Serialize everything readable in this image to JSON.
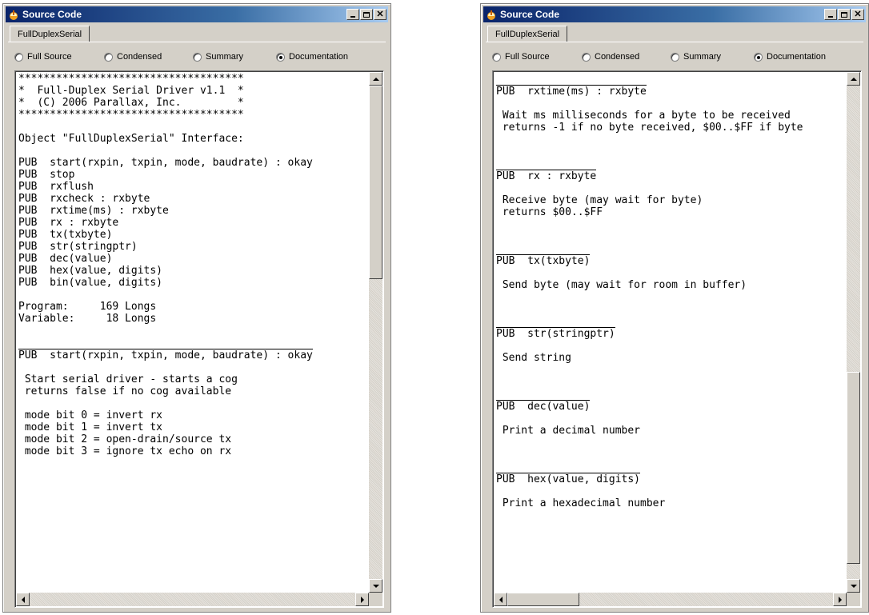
{
  "windows": [
    {
      "title": "Source Code",
      "tab": "FullDuplexSerial",
      "view_modes": [
        {
          "label": "Full Source",
          "selected": false
        },
        {
          "label": "Condensed",
          "selected": false
        },
        {
          "label": "Summary",
          "selected": false
        },
        {
          "label": "Documentation",
          "selected": true
        }
      ],
      "lines": [
        "************************************",
        "*  Full-Duplex Serial Driver v1.1  *",
        "*  (C) 2006 Parallax, Inc.         *",
        "************************************",
        "",
        "Object \"FullDuplexSerial\" Interface:",
        "",
        "PUB  start(rxpin, txpin, mode, baudrate) : okay",
        "PUB  stop",
        "PUB  rxflush",
        "PUB  rxcheck : rxbyte",
        "PUB  rxtime(ms) : rxbyte",
        "PUB  rx : rxbyte",
        "PUB  tx(txbyte)",
        "PUB  str(stringptr)",
        "PUB  dec(value)",
        "PUB  hex(value, digits)",
        "PUB  bin(value, digits)",
        "",
        "Program:     169 Longs",
        "Variable:     18 Longs",
        "",
        "",
        "PUB  start(rxpin, txpin, mode, baudrate) : okay",
        "",
        " Start serial driver - starts a cog",
        " returns false if no cog available",
        "",
        " mode bit 0 = invert rx",
        " mode bit 1 = invert tx",
        " mode bit 2 = open-drain/source tx",
        " mode bit 3 = ignore tx echo on rx"
      ],
      "separator_lines": [
        23
      ]
    },
    {
      "title": "Source Code",
      "tab": "FullDuplexSerial",
      "view_modes": [
        {
          "label": "Full Source",
          "selected": false
        },
        {
          "label": "Condensed",
          "selected": false
        },
        {
          "label": "Summary",
          "selected": false
        },
        {
          "label": "Documentation",
          "selected": true
        }
      ],
      "lines": [
        "",
        "PUB  rxtime(ms) : rxbyte",
        "",
        " Wait ms milliseconds for a byte to be received",
        " returns -1 if no byte received, $00..$FF if byte",
        "",
        "",
        "",
        "PUB  rx : rxbyte",
        "",
        " Receive byte (may wait for byte)",
        " returns $00..$FF",
        "",
        "",
        "",
        "PUB  tx(txbyte)",
        "",
        " Send byte (may wait for room in buffer)",
        "",
        "",
        "",
        "PUB  str(stringptr)",
        "",
        " Send string",
        "",
        "",
        "",
        "PUB  dec(value)",
        "",
        " Print a decimal number",
        "",
        "",
        "",
        "PUB  hex(value, digits)",
        "",
        " Print a hexadecimal number",
        "",
        "",
        ""
      ],
      "separator_lines": [
        1,
        8,
        15,
        21,
        27,
        33
      ]
    }
  ]
}
